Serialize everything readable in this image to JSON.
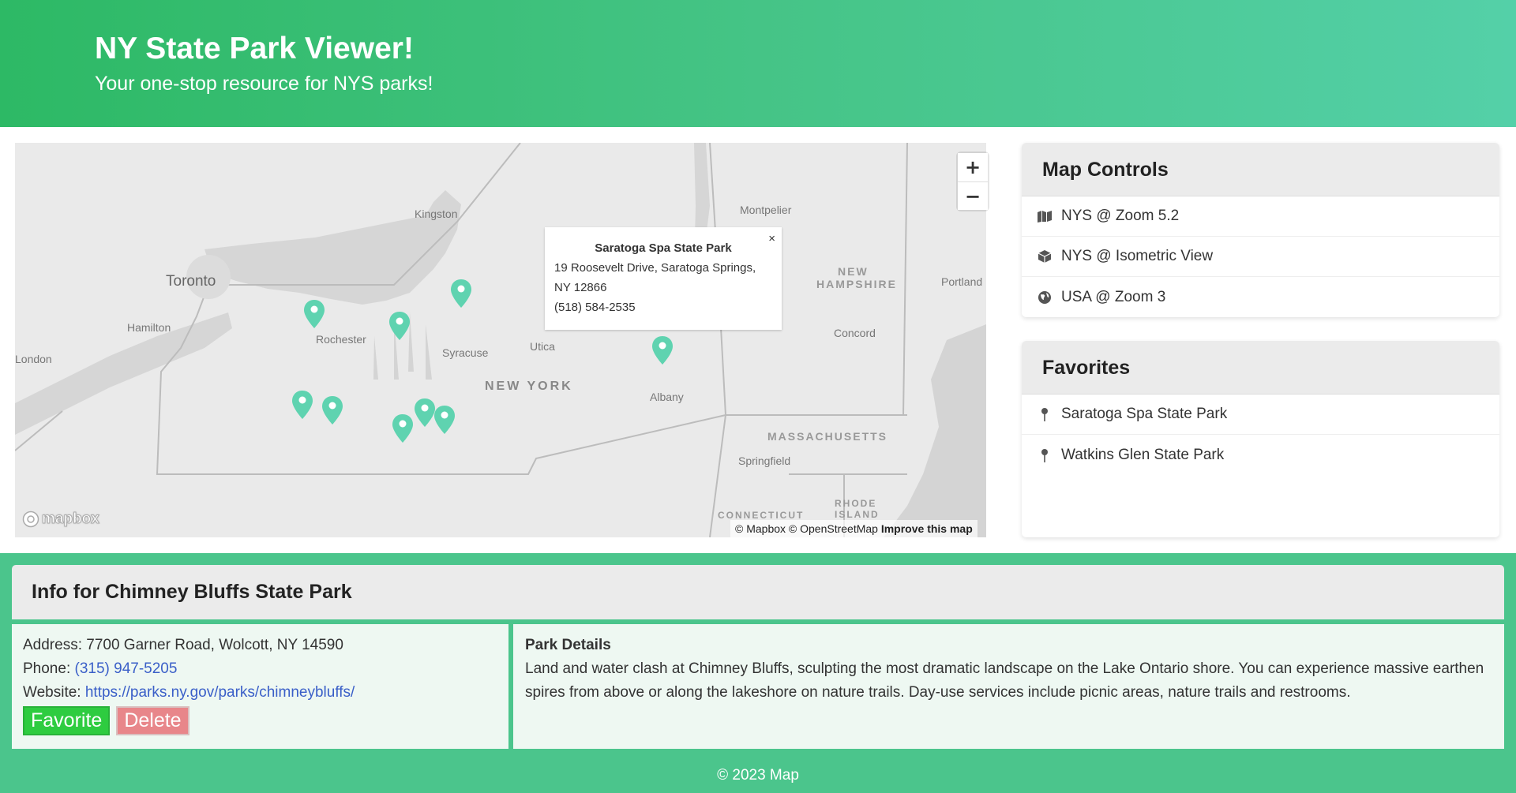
{
  "header": {
    "title": "NY State Park Viewer!",
    "subtitle": "Your one-stop resource for NYS parks!"
  },
  "map": {
    "zoom_in_label": "+",
    "zoom_out_label": "−",
    "labels": {
      "toronto": "Toronto",
      "hamilton": "Hamilton",
      "london": "London",
      "kingston": "Kingston",
      "rochester": "Rochester",
      "syracuse": "Syracuse",
      "utica": "Utica",
      "new_york": "NEW YORK",
      "albany": "Albany",
      "montpelier": "Montpelier",
      "new_hampshire_1": "NEW",
      "new_hampshire_2": "HAMPSHIRE",
      "concord": "Concord",
      "portland": "Portland",
      "massachusetts": "MASSACHUSETTS",
      "springfield": "Springfield",
      "connecticut": "CONNECTICUT",
      "rhode_1": "RHODE",
      "rhode_2": "ISLAND"
    },
    "popup": {
      "title": "Saratoga Spa State Park",
      "address_line1": "19 Roosevelt Drive, Saratoga Springs,",
      "address_line2": "NY 12866",
      "phone": "(518) 584-2535",
      "close": "×"
    },
    "logo": "mapbox",
    "attribution": "© Mapbox © OpenStreetMap",
    "improve": "Improve this map",
    "pin_color": "#5fd3b0"
  },
  "map_controls": {
    "title": "Map Controls",
    "items": [
      {
        "icon": "map-icon",
        "label": "NYS @ Zoom 5.2"
      },
      {
        "icon": "cube-icon",
        "label": "NYS @ Isometric View"
      },
      {
        "icon": "globe-icon",
        "label": "USA @ Zoom 3"
      }
    ]
  },
  "favorites": {
    "title": "Favorites",
    "items": [
      {
        "icon": "pin-icon",
        "label": "Saratoga Spa State Park"
      },
      {
        "icon": "pin-icon",
        "label": "Watkins Glen State Park"
      }
    ]
  },
  "info": {
    "title": "Info for Chimney Bluffs State Park",
    "address_label": "Address:",
    "address": "7700 Garner Road, Wolcott, NY 14590",
    "phone_label": "Phone:",
    "phone": "(315) 947-5205",
    "website_label": "Website:",
    "website": "https://parks.ny.gov/parks/chimneybluffs/",
    "favorite_button": "Favorite",
    "delete_button": "Delete",
    "details_title": "Park Details",
    "details": "Land and water clash at Chimney Bluffs, sculpting the most dramatic landscape on the Lake Ontario shore. You can experience massive earthen spires from above or along the lakeshore on nature trails. Day-use services include picnic areas, nature trails and restrooms."
  },
  "footer": "© 2023 Map",
  "colors": {
    "header_gradient_start": "#2db965",
    "header_gradient_end": "#54d0a8",
    "bottom_bg": "#4bc58c",
    "favorite": "#2ecc40",
    "delete": "#e8868a",
    "link": "#3a5fc8"
  }
}
